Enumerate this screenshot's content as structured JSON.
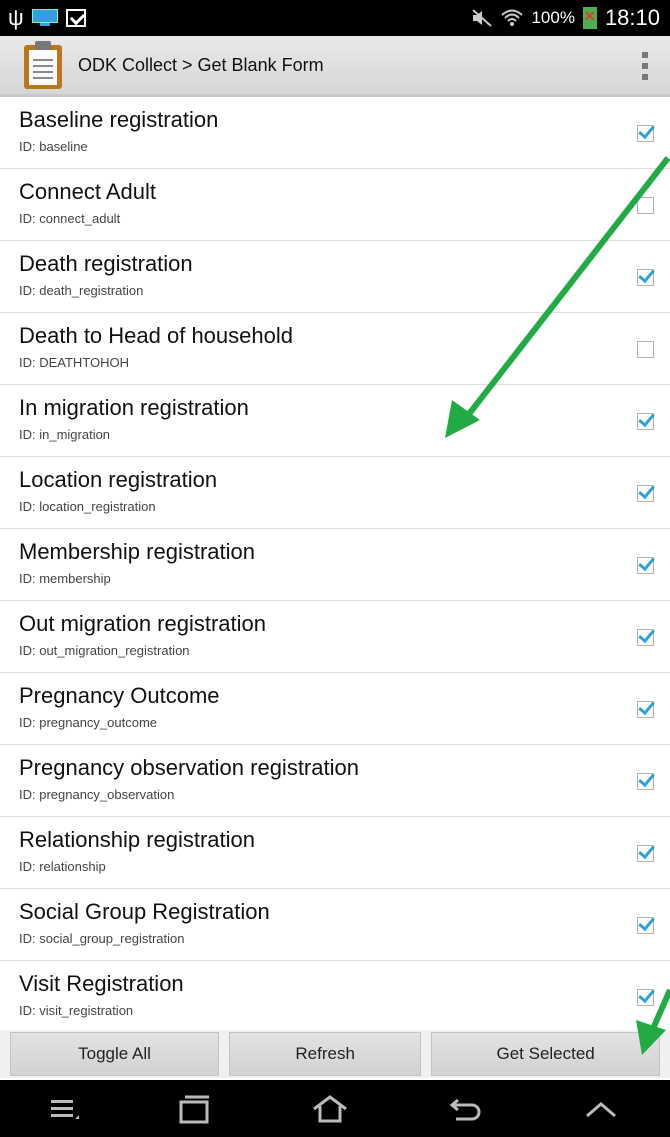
{
  "status_bar": {
    "battery_percent": "100%",
    "time": "18:10"
  },
  "app_bar": {
    "title": "ODK Collect > Get Blank Form"
  },
  "forms": [
    {
      "title": "Baseline registration",
      "id": "ID: baseline",
      "checked": true
    },
    {
      "title": "Connect Adult",
      "id": "ID: connect_adult",
      "checked": false
    },
    {
      "title": "Death registration",
      "id": "ID: death_registration",
      "checked": true
    },
    {
      "title": "Death to Head of household",
      "id": "ID: DEATHTOHOH",
      "checked": false
    },
    {
      "title": "In migration registration",
      "id": "ID: in_migration",
      "checked": true
    },
    {
      "title": "Location registration",
      "id": "ID: location_registration",
      "checked": true
    },
    {
      "title": "Membership registration",
      "id": "ID: membership",
      "checked": true
    },
    {
      "title": "Out migration registration",
      "id": "ID: out_migration_registration",
      "checked": true
    },
    {
      "title": "Pregnancy Outcome",
      "id": "ID: pregnancy_outcome",
      "checked": true
    },
    {
      "title": "Pregnancy observation  registration",
      "id": "ID: pregnancy_observation",
      "checked": true
    },
    {
      "title": "Relationship registration",
      "id": "ID: relationship",
      "checked": true
    },
    {
      "title": "Social Group Registration",
      "id": "ID: social_group_registration",
      "checked": true
    },
    {
      "title": "Visit Registration",
      "id": "ID: visit_registration",
      "checked": true
    }
  ],
  "buttons": {
    "toggle_all": "Toggle All",
    "refresh": "Refresh",
    "get_selected": "Get Selected"
  },
  "colors": {
    "checkmark": "#2f9fe0",
    "annotation_arrow": "#22aa44"
  }
}
